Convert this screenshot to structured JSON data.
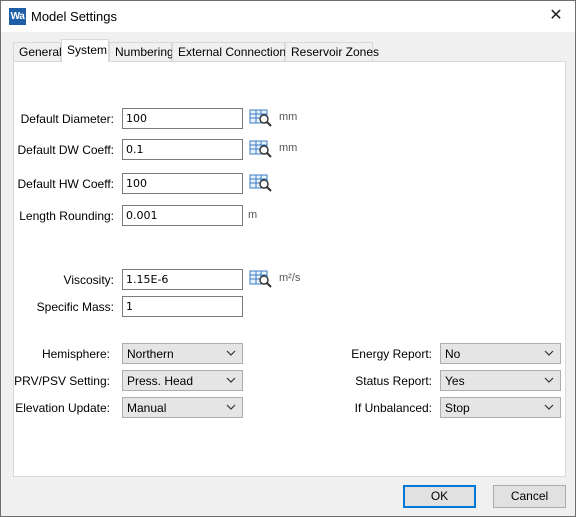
{
  "window": {
    "icon_text": "Wa",
    "title": "Model Settings",
    "close_glyph": "✕"
  },
  "tabs": [
    {
      "label": "General",
      "active": false
    },
    {
      "label": "System",
      "active": true
    },
    {
      "label": "Numbering",
      "active": false
    },
    {
      "label": "External Connections",
      "active": false
    },
    {
      "label": "Reservoir Zones",
      "active": false
    }
  ],
  "fields": {
    "default_diameter": {
      "label": "Default Diameter:",
      "value": "100",
      "unit": "mm",
      "lookup_icon": "table-lookup-icon"
    },
    "default_dw_coeff": {
      "label": "Default DW Coeff:",
      "value": "0.1",
      "unit": "mm",
      "lookup_icon": "table-lookup-icon"
    },
    "default_hw_coeff": {
      "label": "Default HW Coeff:",
      "value": "100",
      "lookup_icon": "table-lookup-icon"
    },
    "length_rounding": {
      "label": "Length Rounding:",
      "value": "0.001",
      "unit": "m"
    },
    "viscosity": {
      "label": "Viscosity:",
      "value": "1.15E-6",
      "unit": "m²/s",
      "lookup_icon": "table-lookup-icon"
    },
    "specific_mass": {
      "label": "Specific Mass:",
      "value": "1"
    }
  },
  "selects": {
    "hemisphere": {
      "label": "Hemisphere:",
      "value": "Northern"
    },
    "prv_psv_setting": {
      "label": "PRV/PSV Setting:",
      "value": "Press. Head"
    },
    "elevation_update": {
      "label": "Elevation Update:",
      "value": "Manual"
    },
    "energy_report": {
      "label": "Energy Report:",
      "value": "No"
    },
    "status_report": {
      "label": "Status Report:",
      "value": "Yes"
    },
    "if_unbalanced": {
      "label": "If Unbalanced:",
      "value": "Stop"
    }
  },
  "buttons": {
    "ok": "OK",
    "cancel": "Cancel"
  }
}
